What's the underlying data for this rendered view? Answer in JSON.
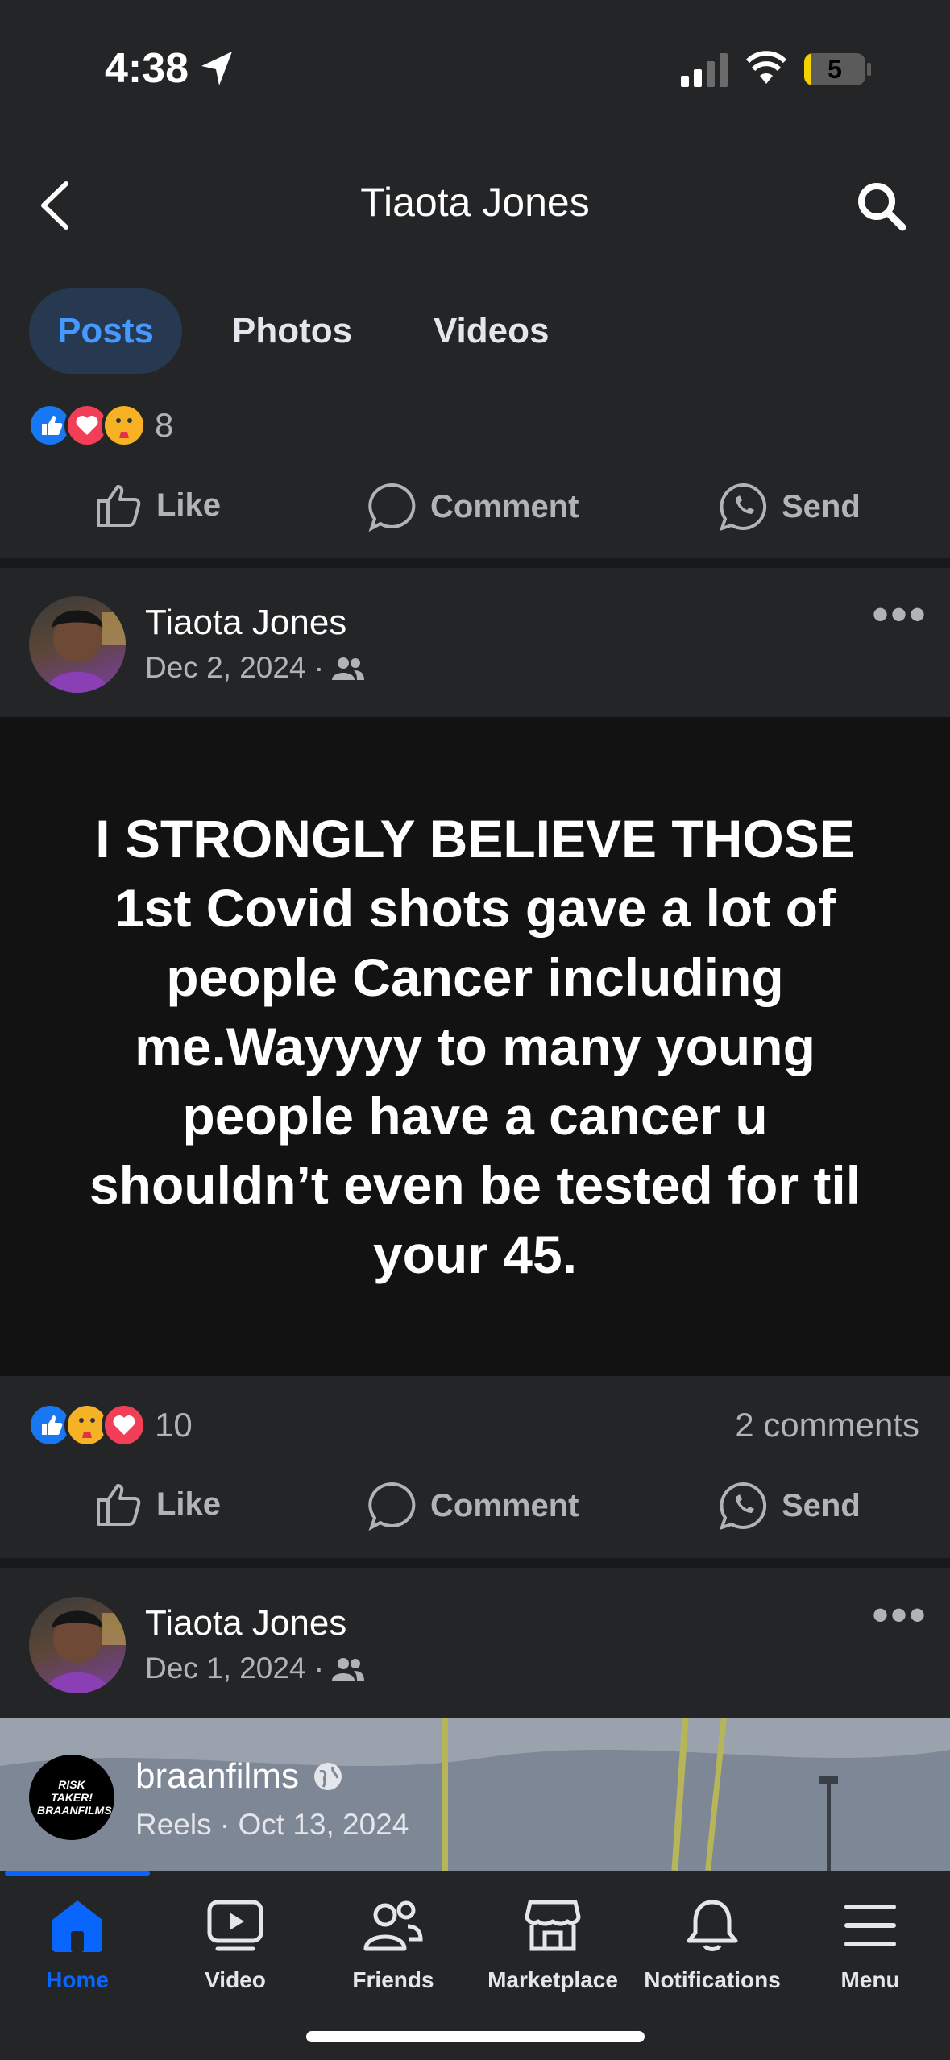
{
  "status_bar": {
    "time": "4:38",
    "battery": "5"
  },
  "header": {
    "title": "Tiaota Jones"
  },
  "tabs": [
    {
      "label": "Posts",
      "active": true
    },
    {
      "label": "Photos",
      "active": false
    },
    {
      "label": "Videos",
      "active": false
    }
  ],
  "prev_post": {
    "reaction_count": "8"
  },
  "actions": {
    "like": "Like",
    "comment": "Comment",
    "send": "Send"
  },
  "post1": {
    "author": "Tiaota Jones",
    "date": "Dec 2, 2024 ·",
    "text": "I STRONGLY BELIEVE THOSE 1st Covid shots gave a lot of people Cancer including me.Wayyyy to many young people have a cancer u shouldn’t even be tested for til your 45.",
    "reaction_count": "10",
    "comments": "2 comments"
  },
  "post2": {
    "author": "Tiaota Jones",
    "date": "Dec 1, 2024 ·",
    "shared_author": "braanfilms",
    "shared_meta": "Reels · Oct 13, 2024",
    "shared_avatar_text": "RISK TAKER! BRAANFILMS"
  },
  "bottom_nav": [
    {
      "label": "Home",
      "icon": "home-icon",
      "active": true
    },
    {
      "label": "Video",
      "icon": "video-icon",
      "active": false
    },
    {
      "label": "Friends",
      "icon": "friends-icon",
      "active": false
    },
    {
      "label": "Marketplace",
      "icon": "marketplace-icon",
      "active": false
    },
    {
      "label": "Notifications",
      "icon": "bell-icon",
      "active": false
    },
    {
      "label": "Menu",
      "icon": "menu-icon",
      "active": false
    }
  ],
  "colors": {
    "background": "#242526",
    "accent": "#0866ff",
    "tab_active_bg": "#263951",
    "tab_active_text": "#4599ff"
  }
}
